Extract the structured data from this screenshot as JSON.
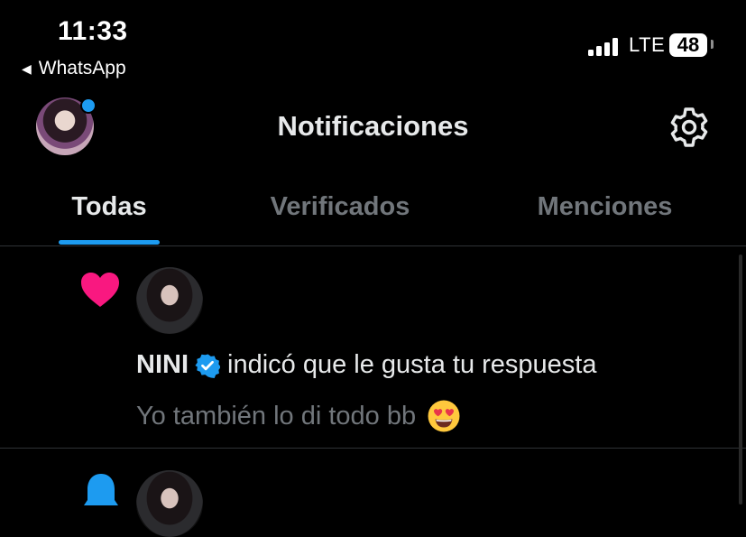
{
  "status_bar": {
    "time": "11:33",
    "back_app": "WhatsApp",
    "network": "LTE",
    "battery": "48"
  },
  "header": {
    "title": "Notificaciones"
  },
  "tabs": [
    {
      "label": "Todas",
      "active": true
    },
    {
      "label": "Verificados",
      "active": false
    },
    {
      "label": "Menciones",
      "active": false
    }
  ],
  "notifications": [
    {
      "type": "like",
      "icon": "heart-icon",
      "user": "NINI",
      "verified": true,
      "action": "indicó que le gusta tu respuesta",
      "preview": "Yo también lo di todo bb",
      "preview_emoji": "heart-eyes-emoji"
    },
    {
      "type": "notification",
      "icon": "bell-icon"
    }
  ],
  "colors": {
    "background": "#000000",
    "accent": "#1d9bf0",
    "like": "#f91880",
    "muted_text": "#71767b",
    "primary_text": "#e7e9ea"
  }
}
